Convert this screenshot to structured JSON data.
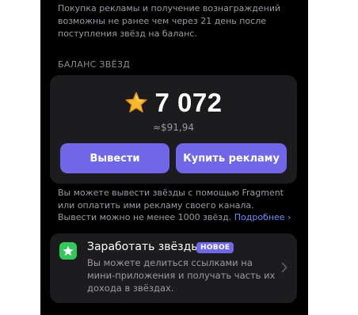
{
  "top_note": "Покупка рекламы и получение вознаграждений возможны не ранее чем через 21 день после поступления звёзд на баланс.",
  "balance_section": {
    "title": "БАЛАНС ЗВЁЗД",
    "star_icon": "star-icon",
    "amount": "7 072",
    "usd": "≈$91,94",
    "withdraw_label": "Вывести",
    "buy_ads_label": "Купить рекламу"
  },
  "info": {
    "text": "Вы можете вывести звёзды с помощью Fragment или оплатить ими рекламу своего канала. Вывести можно не менее 1000 звёзд. ",
    "link": "Подробнее ›"
  },
  "earn": {
    "icon": "earn-stars-icon",
    "title": "Заработать звёзды",
    "badge": "НОВОЕ",
    "description": "Вы можете делиться ссылками на мини-приложения и получать часть их дохода в звёздах."
  },
  "colors": {
    "accent": "#6f67e8",
    "link": "#6f8fff",
    "star": "#f5b82e",
    "earn_icon": "#34c759",
    "card": "#1c1c1e",
    "background": "#000000"
  }
}
